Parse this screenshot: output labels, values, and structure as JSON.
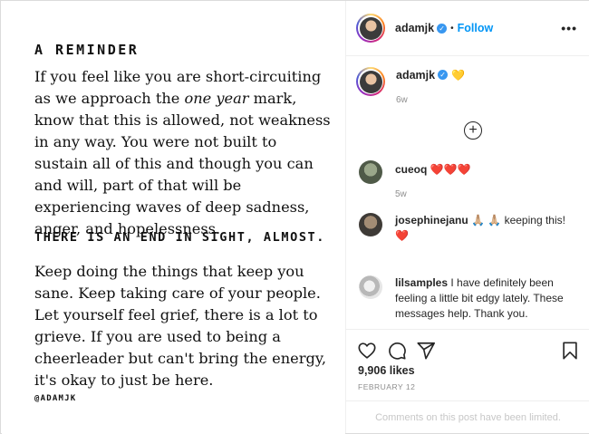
{
  "post_image": {
    "title": "A REMINDER",
    "paragraph1_pre": "If you feel like you are short-circuiting as we approach the ",
    "paragraph1_em": "one year",
    "paragraph1_post": " mark, know that this is allowed, not weakness in any way. You were not built to sustain all of this and though you can and will, part of that will be experiencing waves of deep sadness, anger, and hopelessness.",
    "end_line": "THERE IS AN END IN SIGHT, ALMOST.",
    "paragraph2": "Keep doing the things that keep you sane. Keep taking care of your people. Let yourself feel grief, there is a lot to grieve. If you are used to being a cheerleader but can't bring the energy, it's okay to just be here.",
    "signature": "@ADAMJK"
  },
  "header": {
    "username": "adamjk",
    "separator": "•",
    "follow_label": "Follow",
    "more_label": "•••",
    "avatar_icon": "profile-avatar"
  },
  "caption": {
    "username": "adamjk",
    "emoji": "💛",
    "time": "6w"
  },
  "load_more_label": "+",
  "comments": [
    {
      "username": "cueoq",
      "text": "",
      "emoji": "❤️❤️❤️",
      "time": "5w"
    },
    {
      "username": "josephinejanu",
      "text": "🙏🏼 🙏🏼 keeping this!",
      "emoji": "❤️",
      "time": ""
    },
    {
      "username": "lilsamples",
      "text": "I have definitely been feeling a little bit edgy lately. These messages help. Thank you.",
      "emoji": "",
      "time": ""
    }
  ],
  "actions": {
    "like_icon": "heart-icon",
    "comment_icon": "comment-icon",
    "share_icon": "paper-plane-icon",
    "save_icon": "bookmark-icon",
    "likes": "9,906 likes",
    "date": "FEBRUARY 12"
  },
  "comments_limited": "Comments on this post have been limited.",
  "colors": {
    "accent_blue": "#0095f6",
    "verified_blue": "#3897f0",
    "heart_red": "#ed1c24",
    "muted_text": "#8e8e8e",
    "border": "#dbdbdb"
  }
}
